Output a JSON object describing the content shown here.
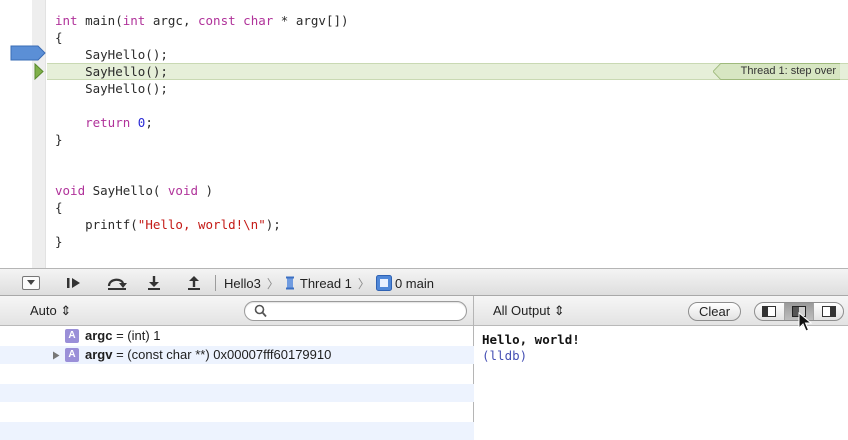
{
  "editor": {
    "lines": [
      {
        "prefix": "",
        "kw1": "int",
        "mid": " main(",
        "kw2": "int",
        "rest": " argc, ",
        "kw3": "const",
        "kw3b": " ",
        "kw4": "char",
        "tail": " * argv[])"
      },
      "{",
      "    SayHello();",
      "    SayHello();",
      "    SayHello();",
      "",
      "    return",
      "}",
      "void",
      "{",
      "    printf(",
      "}"
    ],
    "main_decl": {
      "int1": "int",
      "name": " main(",
      "int2": "int",
      "argc": " argc, ",
      "const": "const",
      "char": "char",
      "argv": " * argv[])"
    },
    "open_brace_1": "{",
    "call_1": "    SayHello();",
    "call_2": "    SayHello();",
    "call_3": "    SayHello();",
    "return_kw": "return",
    "return_val": "0",
    "return_end": ";",
    "close_brace_1": "}",
    "void_kw": "void",
    "sayhello_name": " SayHello( ",
    "void_param": "void",
    "sayhello_end": " )",
    "open_brace_2": "{",
    "printf_name": "printf(",
    "printf_str": "\"Hello, world!\\n\"",
    "printf_end": ");",
    "close_brace_2": "}",
    "thread_badge": "Thread 1: step over",
    "colors": {
      "keyword": "#b0329a",
      "string": "#c41a16",
      "number": "#2a2ad6",
      "exec_highlight": "#e6efd9",
      "breakpoint": "#5b8fd6"
    }
  },
  "debug_bar": {
    "buttons": [
      "hide-debug-area-icon",
      "continue-icon",
      "step-over-icon",
      "step-into-icon",
      "step-out-icon"
    ],
    "jump_bar": {
      "target": "Hello3",
      "thread": "Thread 1",
      "frame": "0 main"
    },
    "separator": "〉"
  },
  "variables_panel": {
    "scope": "Auto ⇕",
    "search_placeholder": "",
    "rows": [
      {
        "type": "A",
        "name": "argc",
        "value": " = (int) 1",
        "expandable": false
      },
      {
        "type": "A",
        "name": "argv",
        "value": " = (const char **) 0x00007fff60179910",
        "expandable": true
      }
    ]
  },
  "console_panel": {
    "output_filter": "All Output ⇕",
    "clear_label": "Clear",
    "lines": [
      "Hello, world!",
      "(lldb)"
    ]
  }
}
